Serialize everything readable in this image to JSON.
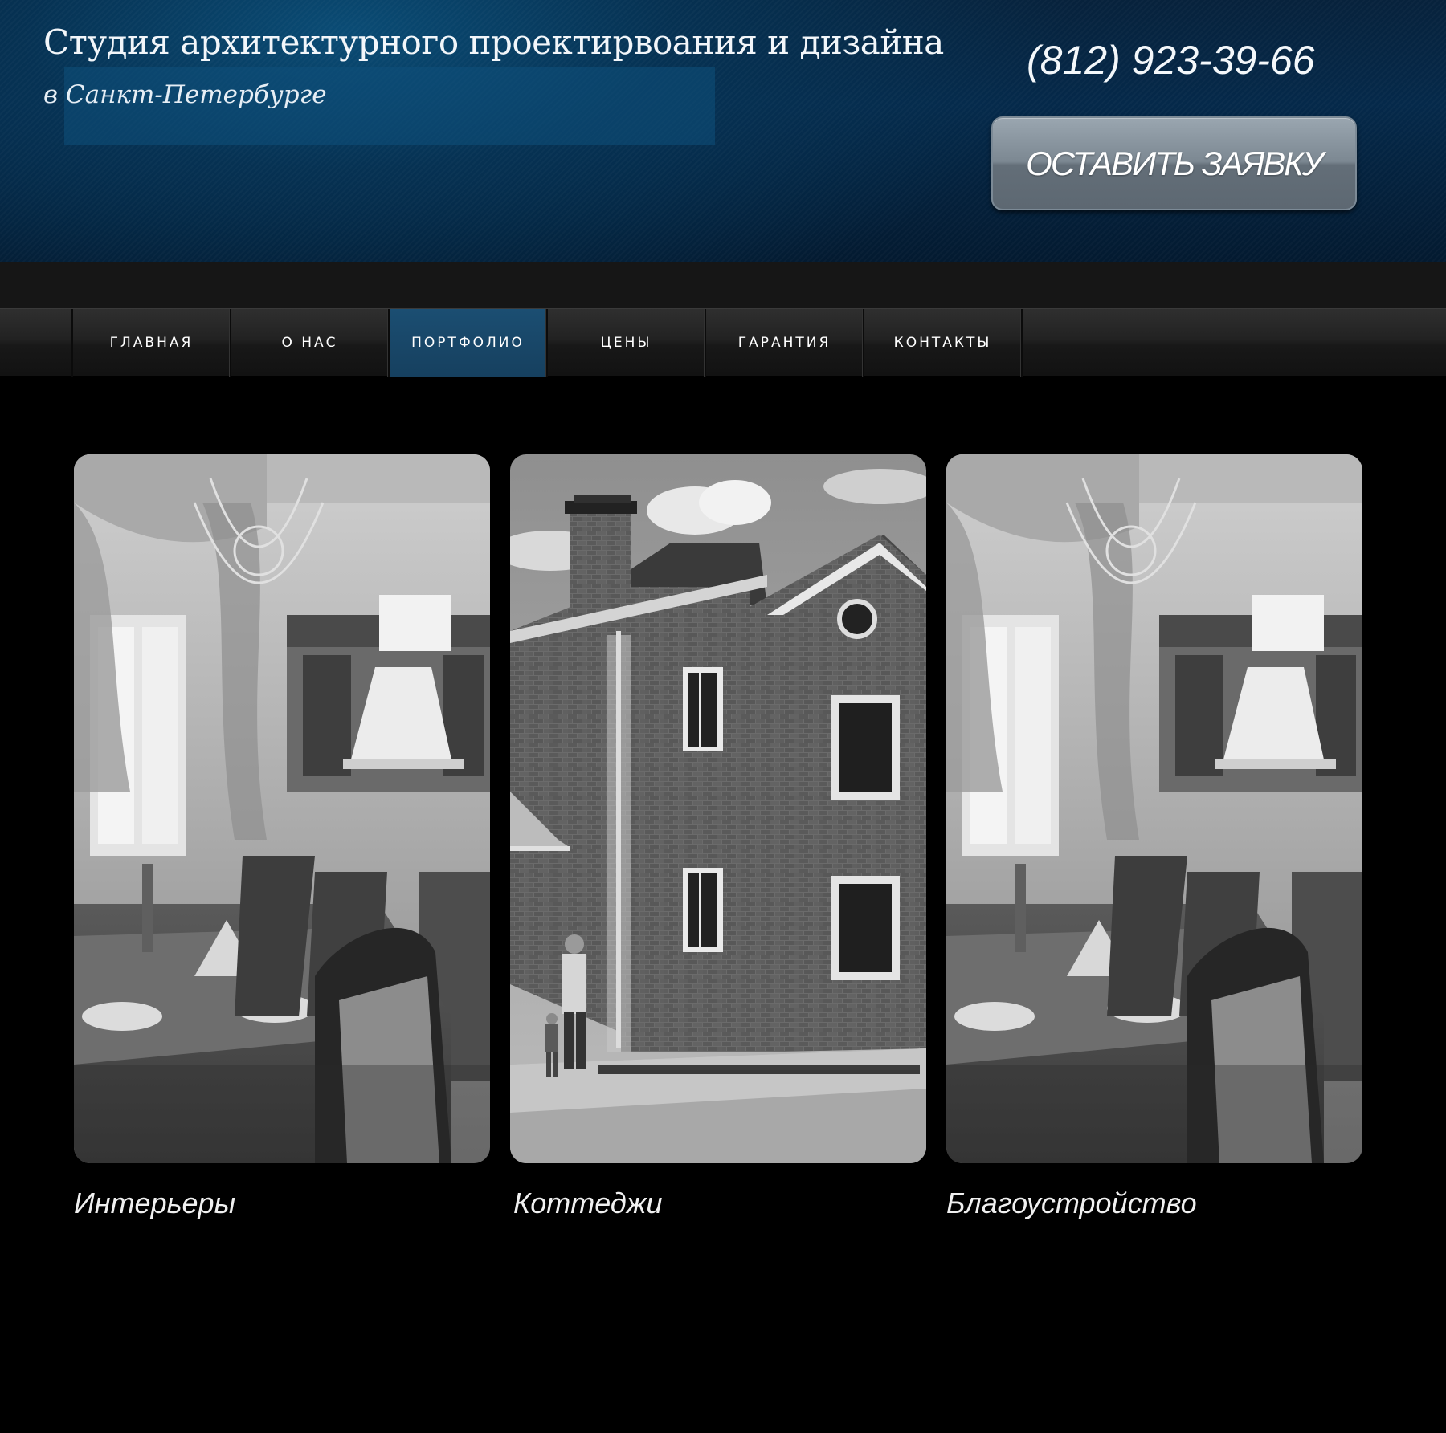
{
  "header": {
    "title": "Студия архитектурного проектирвоания и дизайна",
    "subtitle": "в Санкт-Петербурге",
    "phone": "(812) 923-39-66",
    "cta_label": "ОСТАВИТЬ ЗАЯВКУ"
  },
  "nav": {
    "items": [
      {
        "label": "ГЛАВНАЯ",
        "active": false
      },
      {
        "label": "О НАС",
        "active": false
      },
      {
        "label": "ПОРТФОЛИО",
        "active": true
      },
      {
        "label": "ЦЕНЫ",
        "active": false
      },
      {
        "label": "ГАРАНТИЯ",
        "active": false
      },
      {
        "label": "КОНТАКТЫ",
        "active": false
      }
    ]
  },
  "portfolio": {
    "cards": [
      {
        "caption": "Интерьеры",
        "image": "dining-room-interior-photo"
      },
      {
        "caption": "Коттеджи",
        "image": "brick-cottage-render"
      },
      {
        "caption": "Благоустройство",
        "image": "dining-room-interior-photo"
      }
    ]
  },
  "colors": {
    "header_blue": "#05294a",
    "nav_active": "#1b4e72",
    "background": "#000000"
  }
}
